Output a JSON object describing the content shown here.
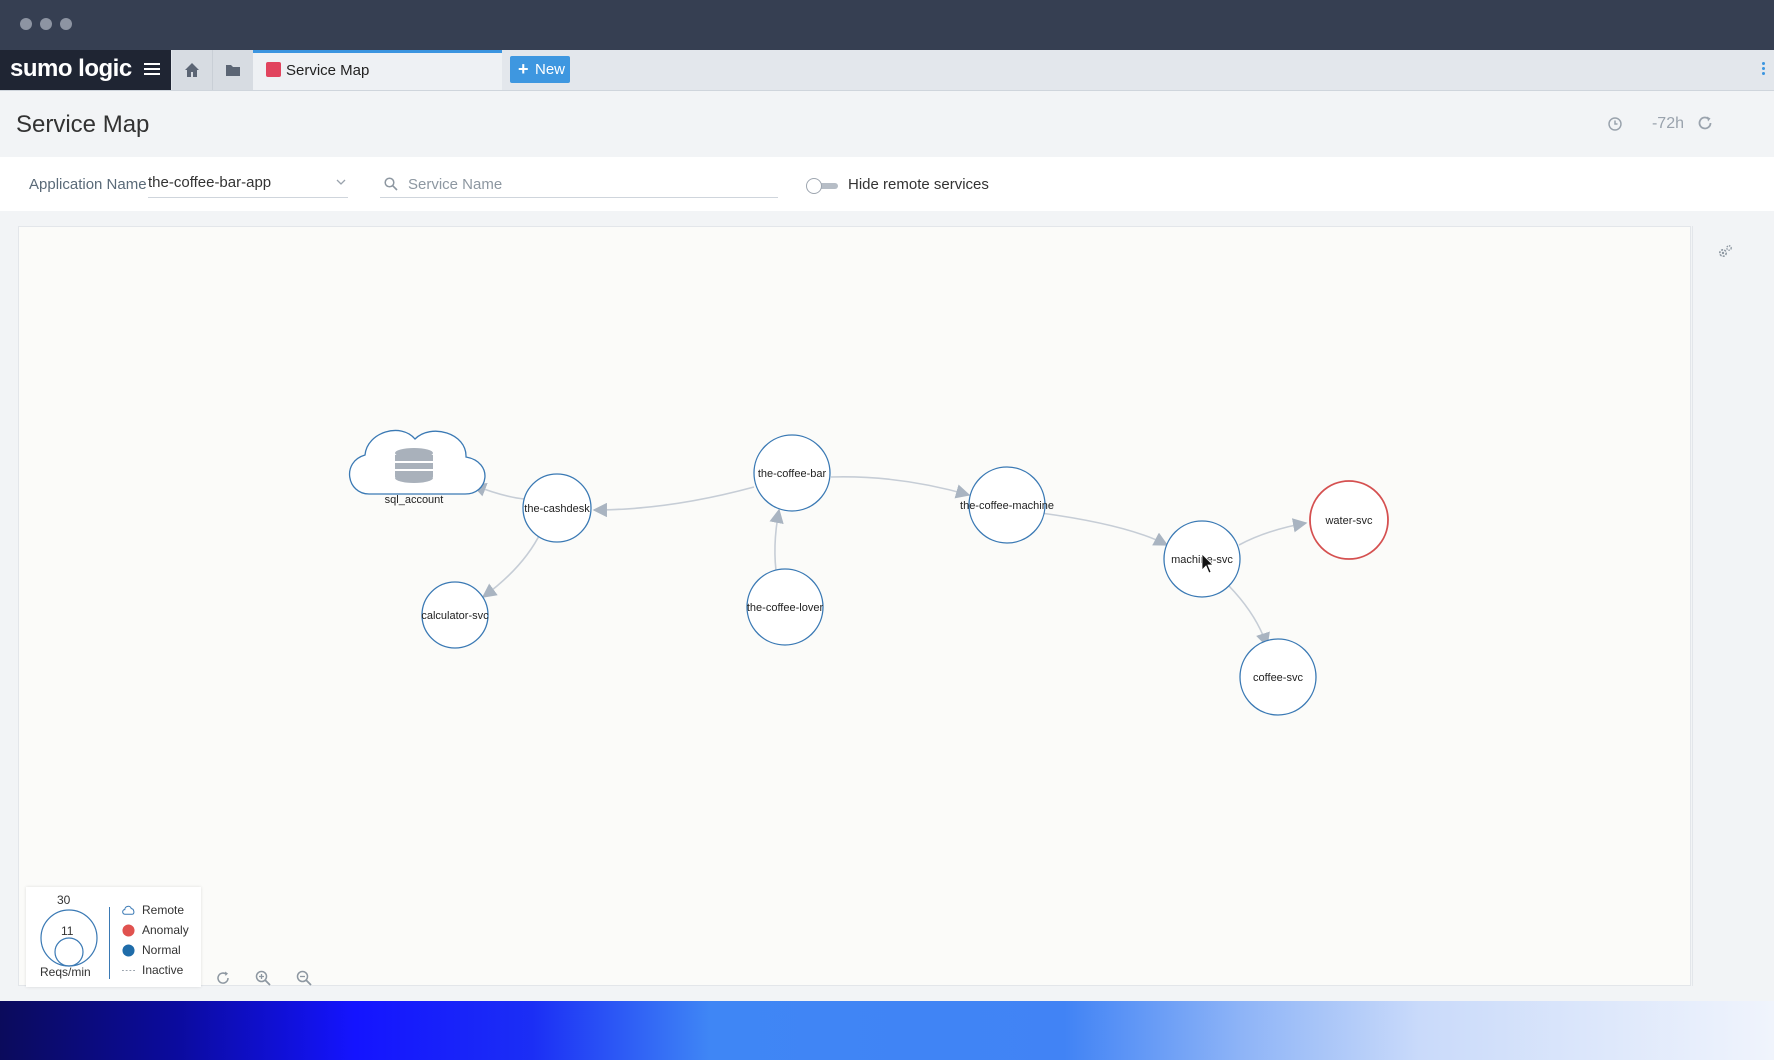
{
  "app": {
    "logo": "sumo logic",
    "tab_label": "Service Map",
    "new_button": "New"
  },
  "header": {
    "title": "Service Map",
    "time_range": "-72h"
  },
  "filters": {
    "application_label": "Application Name",
    "application_value": "the-coffee-bar-app",
    "service_placeholder": "Service Name",
    "hide_remote_label": "Hide remote services",
    "hide_remote_on": false
  },
  "colors": {
    "normal": "#3a79b4",
    "anomaly": "#d55050",
    "accent": "#3e97e0"
  },
  "map": {
    "nodes": {
      "sql_account": {
        "label": "sql_account",
        "kind": "remote",
        "icon": "database-icon"
      },
      "the_cashdesk": {
        "label": "the-cashdesk",
        "status": "normal"
      },
      "calculator_svc": {
        "label": "calculator-svc",
        "status": "normal"
      },
      "the_coffee_bar": {
        "label": "the-coffee-bar",
        "status": "normal"
      },
      "the_coffee_lover": {
        "label": "the-coffee-lover",
        "status": "normal"
      },
      "the_coffee_machine": {
        "label": "the-coffee-machine",
        "status": "normal"
      },
      "machine_svc": {
        "label": "machine-svc",
        "status": "normal"
      },
      "water_svc": {
        "label": "water-svc",
        "status": "anomaly"
      },
      "coffee_svc": {
        "label": "coffee-svc",
        "status": "normal"
      }
    }
  },
  "legend": {
    "size_max": "30",
    "size_mid": "11",
    "size_unit": "Reqs/min",
    "remote": "Remote",
    "anomaly": "Anomaly",
    "normal": "Normal",
    "inactive": "Inactive"
  }
}
